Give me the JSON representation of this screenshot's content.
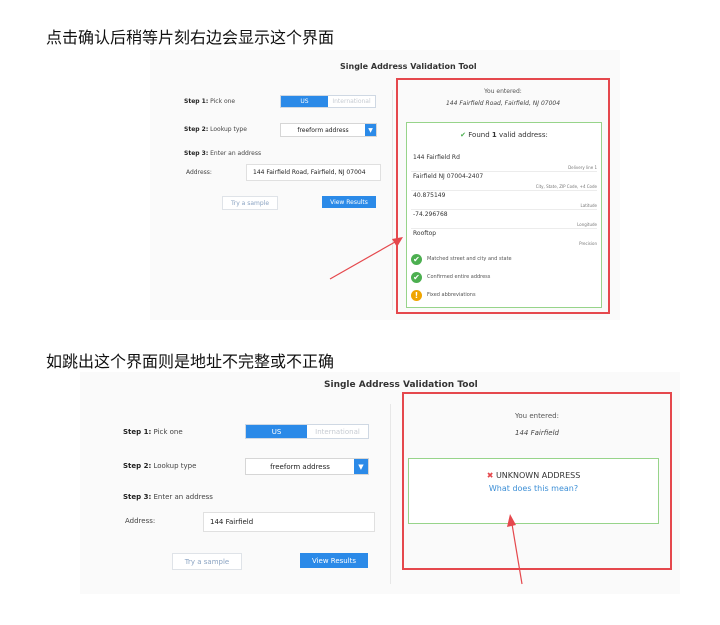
{
  "headings": {
    "first": "点击确认后稍等片刻右边会显示这个界面",
    "second": "如跳出这个界面则是地址不完整或不正确"
  },
  "tool": {
    "title": "Single Address Validation Tool",
    "step1_bold": "Step 1:",
    "step1_text": " Pick one",
    "step2_bold": "Step 2:",
    "step2_text": " Lookup type",
    "step3_bold": "Step 3:",
    "step3_text": " Enter an address",
    "country_us": "US",
    "country_intl": "International",
    "lookup_selected": "freeform address",
    "address_label": "Address:",
    "try_sample": "Try a sample",
    "view_results": "View Results",
    "you_entered": "You entered:"
  },
  "screen1": {
    "address_value": "144 Fairfield Road, Fairfield, NJ 07004",
    "entered_value": "144 Fairfield Road, Fairfield, NJ 07004",
    "found_prefix": "Found ",
    "found_count": "1",
    "found_suffix": " valid address:",
    "results": [
      {
        "value": "144 Fairfield Rd",
        "caption": "Delivery line 1"
      },
      {
        "value": "Fairfield NJ 07004-2407",
        "caption": "City, State, ZIP Code, +4 Code"
      },
      {
        "value": "40.875149",
        "caption": "Latitude"
      },
      {
        "value": "-74.296768",
        "caption": "Longitude"
      },
      {
        "value": "Rooftop",
        "caption": "Precision"
      }
    ],
    "checks": [
      {
        "text": "Matched street and city and state",
        "status": "ok"
      },
      {
        "text": "Confirmed entire address",
        "status": "ok"
      },
      {
        "text": "Fixed abbreviations",
        "status": "warn"
      }
    ]
  },
  "screen2": {
    "address_value": "144 Fairfield",
    "entered_value": "144 Fairfield",
    "unknown": "UNKNOWN ADDRESS",
    "what_means": "What does this mean?"
  },
  "colors": {
    "accent": "#2b8ae8",
    "highlight_red": "#e5484d",
    "success_green": "#97d48a",
    "ok_badge": "#4caf50",
    "warn_badge": "#f0a500"
  }
}
